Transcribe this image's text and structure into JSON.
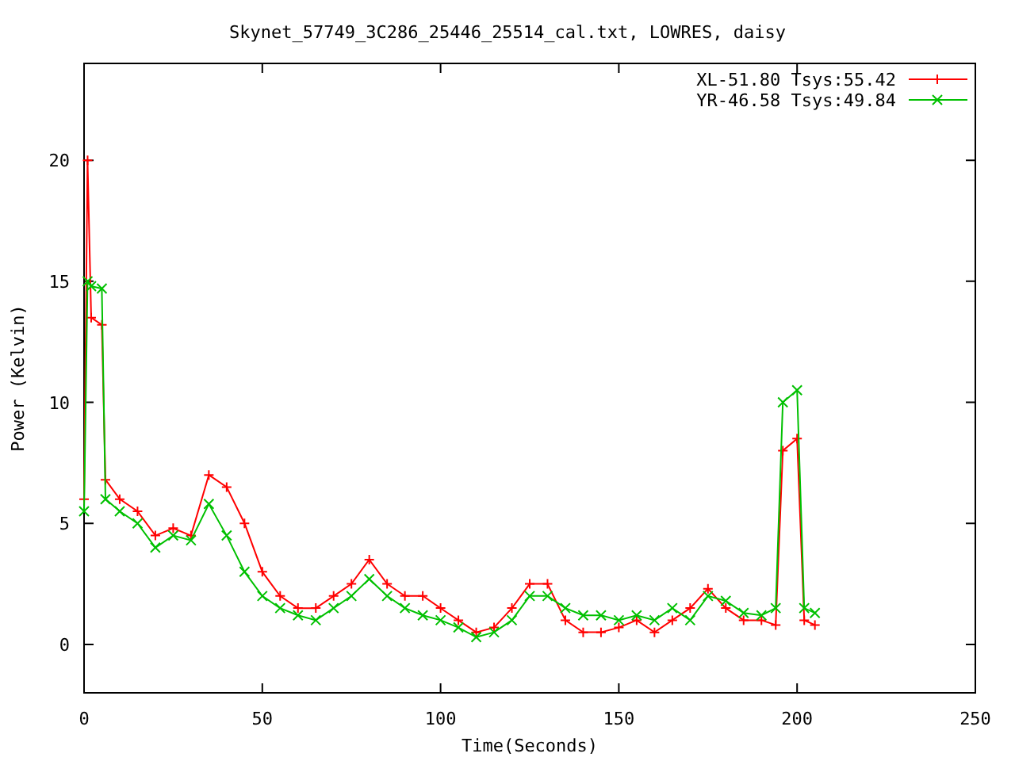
{
  "chart": {
    "chart_data": {
      "type": "line",
      "title": "Skynet_57749_3C286_25446_25514_cal.txt, LOWRES, daisy",
      "xlabel": "Time(Seconds)",
      "ylabel": "Power (Kelvin)",
      "x": [
        0,
        1,
        2,
        5,
        6,
        10,
        15,
        20,
        25,
        30,
        35,
        40,
        45,
        50,
        55,
        60,
        65,
        70,
        75,
        80,
        85,
        90,
        95,
        100,
        105,
        110,
        115,
        120,
        125,
        130,
        135,
        140,
        145,
        150,
        155,
        160,
        165,
        170,
        175,
        180,
        185,
        190,
        194,
        196,
        200,
        202,
        205
      ],
      "series": [
        {
          "name": "XL-51.80 Tsys:55.42",
          "color": "#ff0000",
          "marker": "plus",
          "values": [
            6,
            20,
            13.5,
            13.2,
            6.8,
            6,
            5.5,
            4.5,
            4.8,
            4.5,
            7,
            6.5,
            5,
            3,
            2,
            1.5,
            1.5,
            2,
            2.5,
            3.5,
            2.5,
            2,
            2,
            1.5,
            1,
            0.5,
            0.7,
            1.5,
            2.5,
            2.5,
            1,
            0.5,
            0.5,
            0.7,
            1,
            0.5,
            1,
            1.5,
            2.3,
            1.5,
            1,
            1,
            0.8,
            8,
            8.5,
            1,
            0.8
          ]
        },
        {
          "name": "YR-46.58 Tsys:49.84",
          "color": "#00c000",
          "marker": "cross",
          "values": [
            5.5,
            15,
            14.8,
            14.7,
            6,
            5.5,
            5,
            4,
            4.5,
            4.3,
            5.8,
            4.5,
            3,
            2,
            1.5,
            1.2,
            1,
            1.5,
            2,
            2.7,
            2,
            1.5,
            1.2,
            1,
            0.7,
            0.3,
            0.5,
            1,
            2,
            2,
            1.5,
            1.2,
            1.2,
            1,
            1.2,
            1,
            1.5,
            1,
            2,
            1.8,
            1.3,
            1.2,
            1.5,
            10,
            10.5,
            1.5,
            1.3
          ]
        }
      ],
      "legend": true,
      "xlim": [
        0,
        250
      ],
      "ylim": [
        -2,
        24
      ],
      "xticks": [
        0,
        50,
        100,
        150,
        200,
        250
      ],
      "yticks": [
        0,
        5,
        10,
        15,
        20
      ]
    }
  }
}
